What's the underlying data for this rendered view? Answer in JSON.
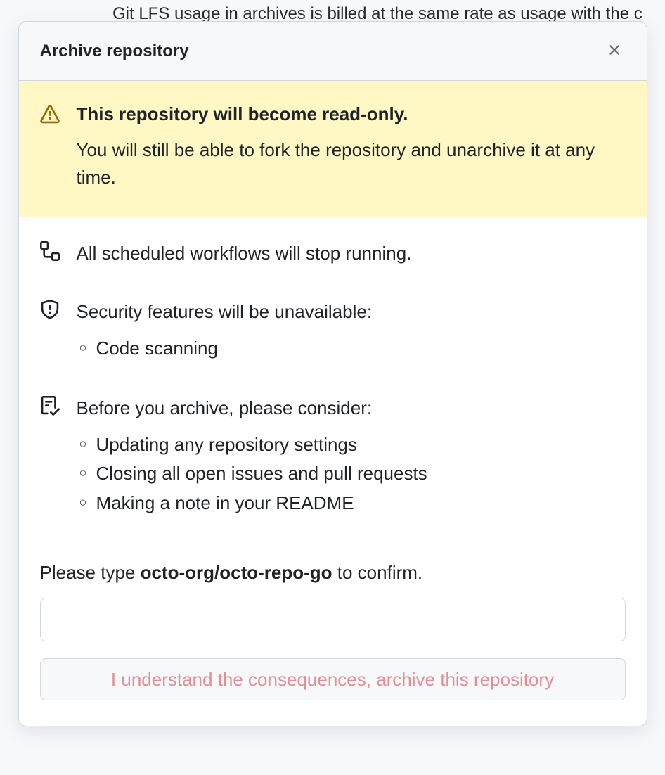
{
  "background": {
    "text": "Git LFS usage in archives is billed at the same rate as usage with the c"
  },
  "modal": {
    "title": "Archive repository",
    "warning": {
      "title": "This repository will become read-only.",
      "description": "You will still be able to fork the repository and unarchive it at any time."
    },
    "workflows_text": "All scheduled workflows will stop running.",
    "security": {
      "text": "Security features will be unavailable:",
      "items": [
        "Code scanning"
      ]
    },
    "consider": {
      "text": "Before you archive, please consider:",
      "items": [
        "Updating any repository settings",
        "Closing all open issues and pull requests",
        "Making a note in your README"
      ]
    },
    "confirm": {
      "prompt_prefix": "Please type ",
      "repo_name": "octo-org/octo-repo-go",
      "prompt_suffix": " to confirm."
    },
    "archive_button_label": "I understand the consequences, archive this repository"
  }
}
